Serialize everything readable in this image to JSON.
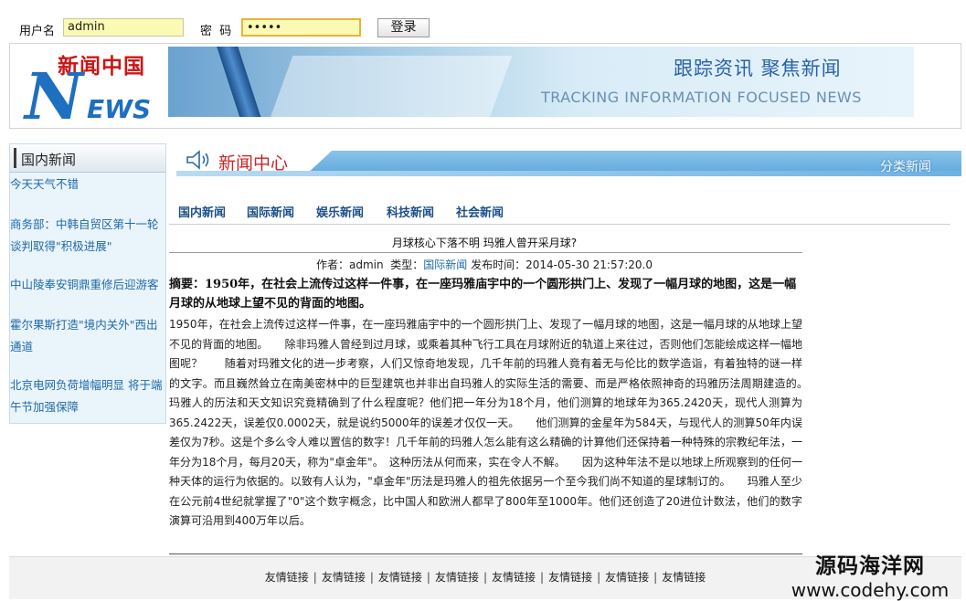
{
  "login": {
    "username_label": "用户名",
    "username_value": "admin",
    "password_label": "密  码",
    "password_value": "•••••",
    "submit_label": "登录"
  },
  "header": {
    "logo_cn": "新闻中国",
    "logo_N": "N",
    "logo_ews": "EWS",
    "slogan_cn": "跟踪资讯 聚焦新闻",
    "slogan_en": "TRACKING INFORMATION FOCUSED NEWS"
  },
  "sidebar": {
    "title": "国内新闻",
    "items": [
      "今天天气不错",
      "商务部：中韩自贸区第十一轮谈判取得\"积极进展\"",
      "中山陵奉安铜鼎重修后迎游客",
      "霍尔果斯打造\"境内关外\"西出通道",
      "北京电网负荷增幅明显 将于端午节加强保障"
    ]
  },
  "main": {
    "section_title": "新闻中心",
    "category_label": "分类新闻",
    "tabs": [
      "国内新闻",
      "国际新闻",
      "娱乐新闻",
      "科技新闻",
      "社会新闻"
    ],
    "article": {
      "title": "月球核心下落不明 玛雅人曾开采月球?",
      "meta_author_label": "作者：",
      "author": "admin",
      "meta_type_label": "类型：",
      "type": "国际新闻",
      "meta_time_label": "发布时间：",
      "time": "2014-05-30 21:57:20.0",
      "summary": "摘要：1950年，在社会上流传过这样一件事，在一座玛雅庙宇中的一个圆形拱门上、发现了一幅月球的地图，这是一幅月球的从地球上望不见的背面的地图。",
      "body": "1950年，在社会上流传过这样一件事，在一座玛雅庙宇中的一个圆形拱门上、发现了一幅月球的地图，这是一幅月球的从地球上望不见的背面的地图。　　除非玛雅人曾经到过月球，或乘着其种飞行工具在月球附近的轨道上来往过，否则他们怎能绘成这样一幅地图呢？　　随着对玛雅文化的进一步考察，人们又惊奇地发现，几千年前的玛雅人竟有着无与伦比的数学造诣，有着独特的谜一样的文字。而且巍然耸立在南美密林中的巨型建筑也并非出自玛雅人的实际生活的需要、而是严格依照神奇的玛雅历法周期建造的。　　玛雅人的历法和天文知识究竟精确到了什么程度呢？他们把一年分为18个月，他们测算的地球年为365.2420天，现代人测算为365.2422天，误差仅0.0002天，就是说约5000年的误差才仅仅一天。　　他们测算的金星年为584天，与现代人的测算50年内误差仅为7秒。这是个多么令人难以置信的数字！几千年前的玛雅人怎么能有这么精确的计算他们还保持着一种特殊的宗教纪年法，一年分为18个月，每月20天，称为\"卓金年\"。　这种历法从何而来，实在令人不解。　　因为这种年法不是以地球上所观察到的任何一种天体的运行为依据的。以致有人认为，\"卓金年\"历法是玛雅人的祖先依据另一个至今我们尚不知道的星球制订的。　　玛雅人至少在公元前4世纪就掌握了\"0\"这个数字概念，比中国人和欧洲人都早了800年至1000年。他们还创造了20进位计数法，他们的数字演算可沿用到400万年以后。"
    }
  },
  "footer": {
    "links": [
      "友情链接",
      "友情链接",
      "友情链接",
      "友情链接",
      "友情链接",
      "友情链接",
      "友情链接",
      "友情链接"
    ]
  },
  "watermark": {
    "line1": "源码海洋网",
    "line2": "www.codehy.com"
  },
  "colors": {
    "accent_blue": "#1d6aa8",
    "title_red": "#cc2525",
    "input_bg": "#fafab4"
  },
  "icons": {
    "speaker": "speaker-icon"
  }
}
